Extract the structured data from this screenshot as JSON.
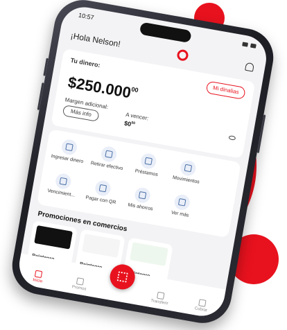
{
  "status": {
    "time": "10:57"
  },
  "header": {
    "greeting": "¡Hola Nelson!"
  },
  "balance_card": {
    "label": "Tu dinero:",
    "digital_button": "Mi dinalias",
    "amount": "$250.000",
    "cents": "00",
    "margin_label": "Margen adicional:",
    "info_button": "Más info",
    "due_label": "A vencer:",
    "due_amount": "$0",
    "due_cents": "00"
  },
  "actions": [
    {
      "label": "Ingresar dinero",
      "icon": "deposit-icon"
    },
    {
      "label": "Retirar efectivo",
      "icon": "withdraw-icon"
    },
    {
      "label": "Préstamos",
      "icon": "loans-icon"
    },
    {
      "label": "Movimientos",
      "icon": "movements-icon"
    },
    {
      "label": "Vencimient...",
      "icon": "calendar-icon"
    },
    {
      "label": "Pagar con QR",
      "icon": "qr-icon"
    },
    {
      "label": "Mis ahorros",
      "icon": "piggy-bank-icon"
    },
    {
      "label": "Ver más",
      "icon": "more-icon"
    }
  ],
  "promotions": {
    "title": "Promociones en comercios",
    "items": [
      "Reintegro",
      "Reintegro",
      "Reintegro"
    ]
  },
  "nav": {
    "items": [
      "Inicio",
      "Promos",
      "Transferir",
      "Cobrar"
    ]
  },
  "colors": {
    "brand": "#e8121e"
  }
}
